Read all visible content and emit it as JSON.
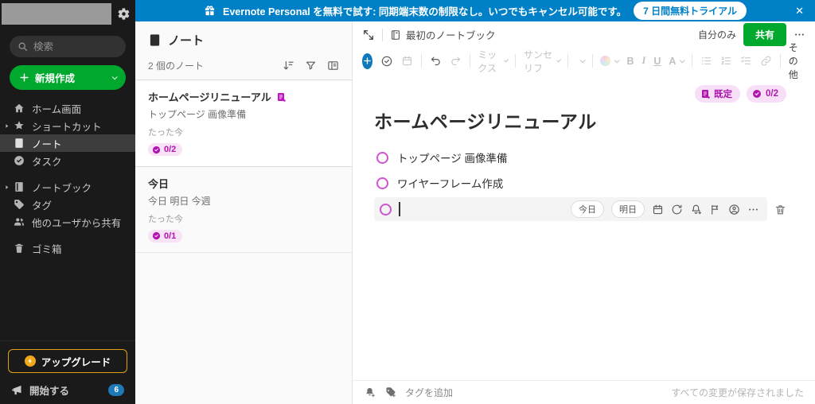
{
  "banner": {
    "text": "Evernote Personal を無料で試す: 同期端末数の制限なし。いつでもキャンセル可能です。",
    "trial_button": "7 日間無料トライアル",
    "close": "✕"
  },
  "sidebar": {
    "search_placeholder": "検索",
    "new_button": "新規作成",
    "items": [
      {
        "label": "ホーム画面"
      },
      {
        "label": "ショートカット"
      },
      {
        "label": "ノート"
      },
      {
        "label": "タスク"
      },
      {
        "label": "ノートブック"
      },
      {
        "label": "タグ"
      },
      {
        "label": "他のユーザから共有"
      },
      {
        "label": "ゴミ箱"
      }
    ],
    "upgrade_button": "アップグレード",
    "get_started": "開始する",
    "get_started_badge": "6"
  },
  "notelist": {
    "title": "ノート",
    "count": "2 個のノート",
    "notes": [
      {
        "title": "ホームページリニューアル",
        "snippet": "トップページ 画像準備",
        "time": "たった今",
        "badge": "0/2"
      },
      {
        "title": "今日",
        "snippet": "今日 明日 今週",
        "time": "たった今",
        "badge": "0/1"
      }
    ]
  },
  "editor": {
    "notebook": "最初のノートブック",
    "visibility": "自分のみ",
    "share_button": "共有",
    "toolbar": {
      "style_dropdown": "ミックス",
      "font_dropdown": "サンセリフ",
      "bold": "B",
      "italic": "I",
      "underline": "U",
      "text_color": "A",
      "more": "その他"
    },
    "pills": {
      "template": "既定",
      "progress": "0/2"
    },
    "title": "ホームページリニューアル",
    "tasks": [
      {
        "text": "トップページ 画像準備"
      },
      {
        "text": "ワイヤーフレーム作成"
      },
      {
        "text": ""
      }
    ],
    "task_row": {
      "today": "今日",
      "tomorrow": "明日"
    },
    "footer": {
      "add_tag": "タグを追加",
      "saved": "すべての変更が保存されました"
    }
  },
  "colors": {
    "banner_blue": "#0081c7",
    "accent_green": "#00a82d",
    "magenta": "#b312b3",
    "sidebar_bg": "#1a1a1a",
    "upgrade_orange": "#dfa112"
  }
}
